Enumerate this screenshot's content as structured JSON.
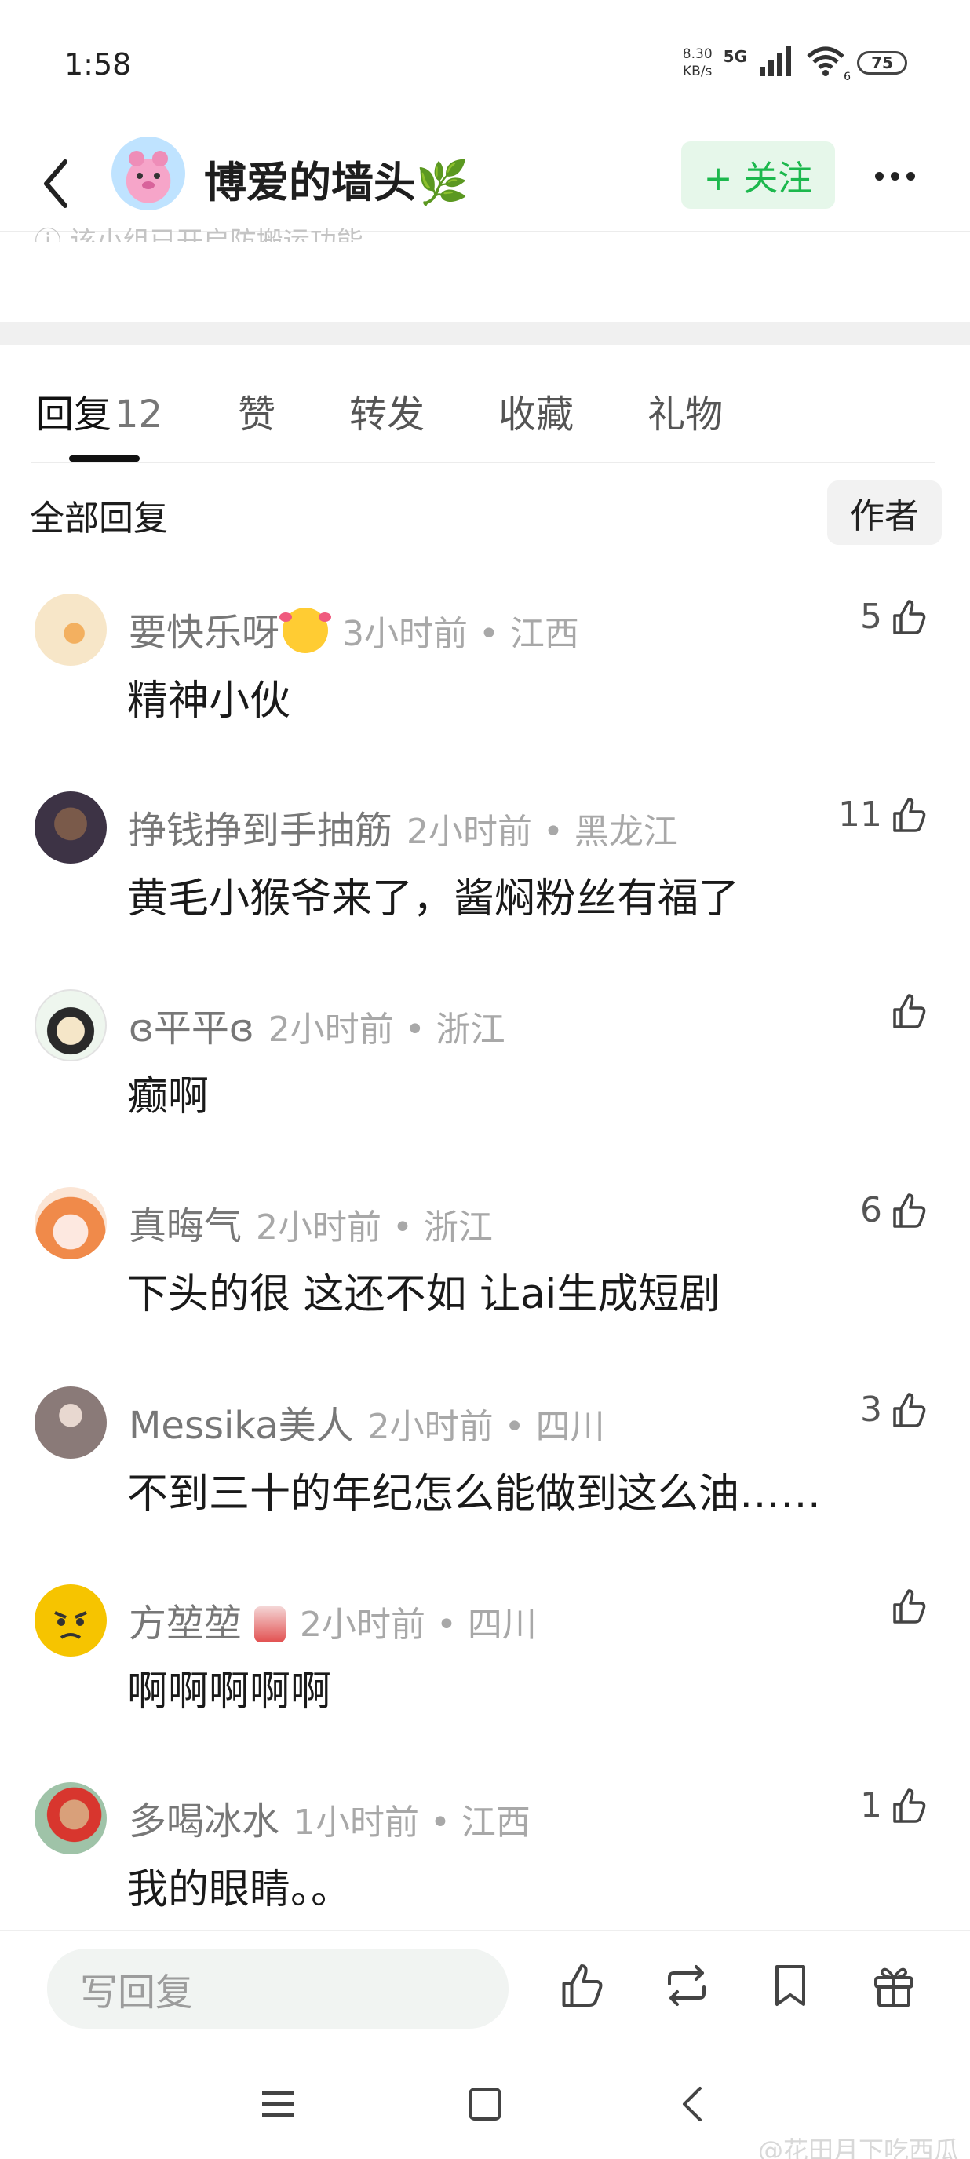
{
  "status_bar": {
    "time": "1:58",
    "net_speed_value": "8.30",
    "net_speed_unit": "KB/s",
    "network_type": "5G",
    "wifi_label": "6",
    "battery": "75"
  },
  "header": {
    "title": "博爱的墙头🌿",
    "follow_label": "+ 关注"
  },
  "partial_notice": "ⓘ 该小组已开启防搬运功能",
  "tabs": [
    {
      "label": "回复",
      "count": "12"
    },
    {
      "label": "赞"
    },
    {
      "label": "转发"
    },
    {
      "label": "收藏"
    },
    {
      "label": "礼物"
    }
  ],
  "filter": {
    "all_label": "全部回复",
    "author_label": "作者"
  },
  "comments": [
    {
      "name": "要快乐呀",
      "time": "3小时前 • 江西",
      "text": "精神小伙",
      "likes": "5"
    },
    {
      "name": "挣钱挣到手抽筋",
      "time": "2小时前 • 黑龙江",
      "text": "黄毛小猴爷来了，酱焖粉丝有福了",
      "likes": "11"
    },
    {
      "name": "ɞ平平ɞ",
      "time": "2小时前 • 浙江",
      "text": "癫啊",
      "likes": ""
    },
    {
      "name": "真晦气",
      "time": "2小时前 • 浙江",
      "text": "下头的很   这还不如 让ai生成短剧",
      "likes": "6"
    },
    {
      "name": "Messika美人",
      "time": "2小时前 • 四川",
      "text": "不到三十的年纪怎么能做到这么油……",
      "likes": "3"
    },
    {
      "name": "方堃堃",
      "time": "2小时前 • 四川",
      "text": "啊啊啊啊啊",
      "likes": ""
    },
    {
      "name": "多喝冰水",
      "time": "1小时前 • 江西",
      "text": "我的眼睛。。",
      "likes": "1"
    }
  ],
  "bottom_bar": {
    "reply_placeholder": "写回复"
  },
  "watermark": "@花田月下吃西瓜",
  "icons": [
    "back-icon",
    "more-icon",
    "thumb-up-icon",
    "repost-icon",
    "bookmark-icon",
    "gift-icon",
    "menu-icon",
    "home-square-icon",
    "nav-back-icon"
  ]
}
